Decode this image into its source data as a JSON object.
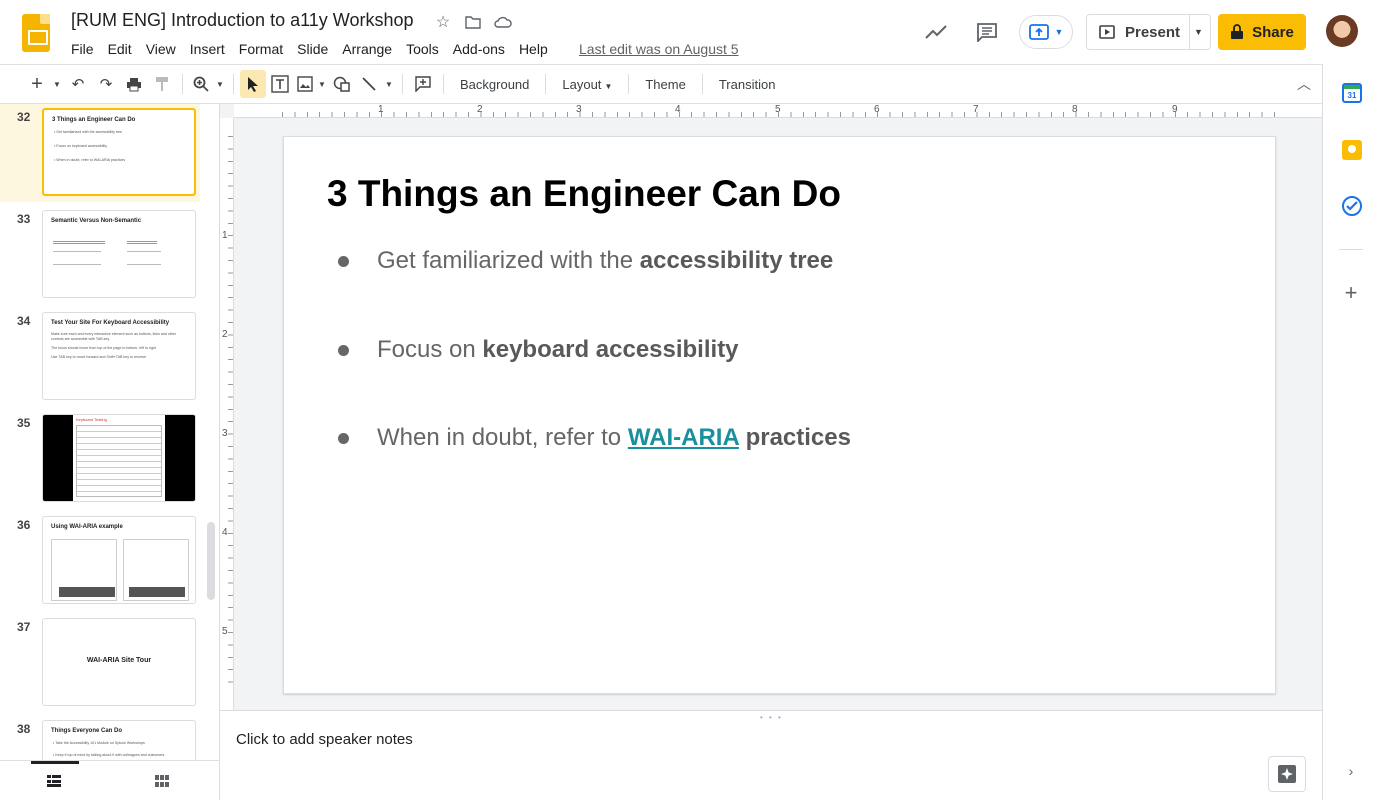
{
  "header": {
    "doc_title": "[RUM ENG] Introduction to a11y Workshop",
    "menu": [
      "File",
      "Edit",
      "View",
      "Insert",
      "Format",
      "Slide",
      "Arrange",
      "Tools",
      "Add-ons",
      "Help"
    ],
    "last_edit": "Last edit was on August 5",
    "present_label": "Present",
    "share_label": "Share",
    "icons": [
      "star-icon",
      "move-to-folder-icon",
      "cloud-saved-icon",
      "activity-trend-icon",
      "comment-icon",
      "publish-icon",
      "present-dropdown-icon",
      "lock-icon"
    ]
  },
  "toolbar": {
    "background": "Background",
    "layout": "Layout",
    "theme": "Theme",
    "transition": "Transition"
  },
  "filmstrip": {
    "slides": [
      {
        "num": "32",
        "title": "3 Things an Engineer Can Do",
        "lines": [
          "• Get familiarized with the accessibility tree",
          "• Focus on keyboard accessibility",
          "• When in doubt, refer to WAI-ARIA practices"
        ]
      },
      {
        "num": "33",
        "title": "Semantic Versus Non-Semantic",
        "lines": []
      },
      {
        "num": "34",
        "title": "Test Your Site For Keyboard Accessibility",
        "lines": [
          "Make sure each and every interactive element such as buttons, links and other",
          "controls are accessible with TAB key.",
          "The focus should move from top of the page to bottom, left to right",
          "Use TAB key to move forward and Shift+TAB key to reverse"
        ]
      },
      {
        "num": "35",
        "title": "Keyboard Testing",
        "lines": []
      },
      {
        "num": "36",
        "title": "Using WAI-ARIA example",
        "lines": []
      },
      {
        "num": "37",
        "title": "WAI-ARIA Site Tour",
        "lines": []
      },
      {
        "num": "38",
        "title": "Things Everyone Can Do",
        "lines": [
          "• Take the Accessibility 101 Module on Splunk Workshops",
          "• Keep it top of mind by talking about it with colleagues and customers"
        ]
      }
    ]
  },
  "rulers": {
    "h": [
      "1",
      "2",
      "3",
      "4",
      "5",
      "6",
      "7",
      "8",
      "9"
    ],
    "v": [
      "1",
      "2",
      "3",
      "4",
      "5"
    ]
  },
  "slide": {
    "title": "3 Things an Engineer Can Do",
    "b1_pre": "Get familiarized with the ",
    "b1_bold": "accessibility tree",
    "b2_pre": "Focus on ",
    "b2_bold": "keyboard accessibility",
    "b3_pre": "When in doubt, refer to ",
    "b3_link": "WAI-ARIA",
    "b3_bold": " practices"
  },
  "notes": {
    "placeholder": "Click to add speaker notes"
  },
  "colors": {
    "accent": "#fbbc04",
    "link": "#1a8f9e"
  }
}
